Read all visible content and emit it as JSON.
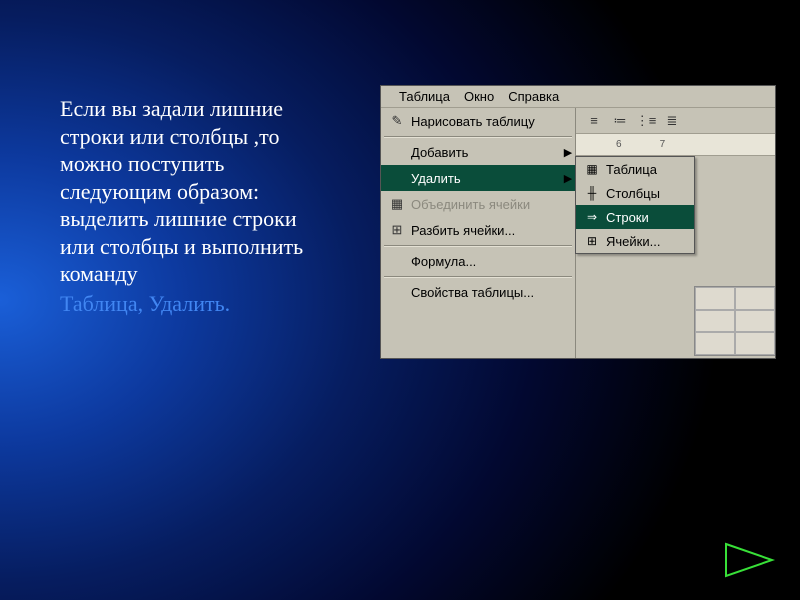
{
  "slide": {
    "body": "Если вы задали лишние строки или столбцы ,то можно поступить следующим образом: выделить лишние строки или столбцы и выполнить команду",
    "accent": "Таблица, Удалить."
  },
  "menubar": {
    "table": "Таблица",
    "window": "Окно",
    "help": "Справка"
  },
  "menu": {
    "draw": "Нарисовать таблицу",
    "add": "Добавить",
    "delete": "Удалить",
    "merge": "Объединить ячейки",
    "split": "Разбить ячейки...",
    "formula": "Формула...",
    "props": "Свойства таблицы..."
  },
  "submenu": {
    "table": "Таблица",
    "columns": "Столбцы",
    "rows": "Строки",
    "cells": "Ячейки..."
  },
  "ruler": {
    "mark6": "6",
    "mark7": "7"
  },
  "icons": {
    "pencil": "✎",
    "merge": "▦",
    "split": "⊞",
    "align_l": "≡",
    "list_b": "≔",
    "list_n": "⋮≡",
    "indent": "≣",
    "sub_table": "▦",
    "sub_cols": "╫",
    "sub_rows": "⇒",
    "sub_cells": "⊞"
  }
}
